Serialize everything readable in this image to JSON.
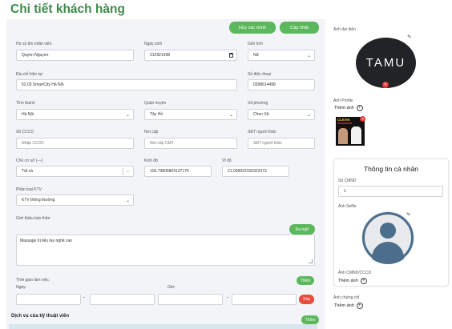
{
  "page": {
    "title": "Chi tiết khách hàng"
  },
  "actions": {
    "verify_cancel": "Hủy xác minh",
    "update": "Cập nhật"
  },
  "form": {
    "employee_name": {
      "label": "Họ và tên nhân viên",
      "value": "Quyen Nguyen"
    },
    "dob": {
      "label": "Ngày sinh",
      "value": "21/05/1998"
    },
    "gender": {
      "label": "Giới tính",
      "value": "Nữ"
    },
    "address": {
      "label": "Địa chỉ hiện tại",
      "value": "52.03 SmartCity Hà Nội"
    },
    "phone": {
      "label": "Số điện thoại",
      "value": "0398614498"
    },
    "province": {
      "label": "Tỉnh thành",
      "value": "Hà Nội"
    },
    "district": {
      "label": "Quận huyện",
      "value": "Tây Hồ"
    },
    "ward": {
      "label": "Xã phường",
      "value": "Chọn Xã"
    },
    "cccd": {
      "label": "Số CCCD",
      "placeholder": "Nhập CCCD"
    },
    "issued_place": {
      "label": "Nơi cấp",
      "placeholder": "Nơi cấp CMT"
    },
    "relative_phone": {
      "label": "SĐT người thân",
      "placeholder": "SĐT người thân"
    },
    "branch": {
      "label": "Chủ cơ sở (---)",
      "value": "Tất cả"
    },
    "longitude": {
      "label": "Kinh độ",
      "value": "105.79806804137175"
    },
    "latitude": {
      "label": "Vĩ độ",
      "value": "21.009922150323373"
    },
    "category": {
      "label": "Phân loại KTV",
      "value": "KTV thông thường"
    },
    "intro": {
      "label": "Giới thiệu bản thân",
      "button": "Đa ngữ",
      "value": "Massage trị liệu tay nghề cao"
    },
    "working_time": {
      "label": "Thời gian làm việc:",
      "add": "Thêm",
      "day_label": "Ngày:",
      "time_label": "Giờ:",
      "dash": "-",
      "delete": "Xóa"
    },
    "services": {
      "title": "Dịch vụ của kỹ thuật viên",
      "add": "Thêm"
    }
  },
  "sidebar": {
    "avatar_label": "Ảnh đại diện",
    "avatar_text": "TAMU",
    "profile_label": "Ảnh Profile",
    "add_photo": "Thêm ảnh",
    "thumb_caption": "CLEAN",
    "personal": {
      "title": "Thông tin cá nhân",
      "cmnd_label": "Số CMND",
      "cmnd_value": "1",
      "selfie_label": "Ảnh Selfie",
      "cmnd_photo_label": "Ảnh CMND/CCCD",
      "add_photo": "Thêm ảnh"
    },
    "cert_label": "Ảnh chứng chỉ",
    "cert_add": "Thêm ảnh"
  },
  "colors": {
    "title_green": "#3e8a4c",
    "button_green": "#5cb85c",
    "delete_red": "#e74c3c",
    "card_bg": "#f2f4f7"
  }
}
